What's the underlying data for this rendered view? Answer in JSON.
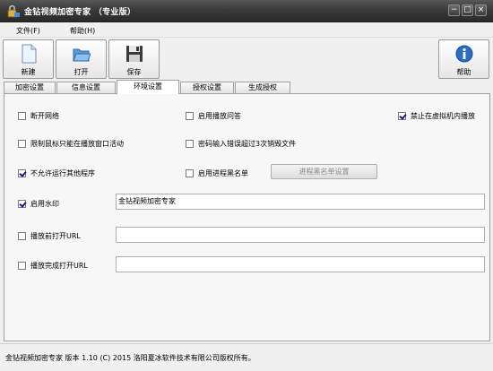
{
  "window": {
    "title": "金钻视频加密专家  （专业版）",
    "controls": {
      "minimize": "−",
      "maximize": "□",
      "close": "×"
    }
  },
  "menu": [
    {
      "label": "文件(F)"
    },
    {
      "label": "帮助(H)"
    }
  ],
  "toolbar": {
    "new_label": "新建",
    "open_label": "打开",
    "save_label": "保存",
    "help_label": "帮助"
  },
  "tabs": [
    {
      "label": "加密设置"
    },
    {
      "label": "信息设置"
    },
    {
      "label": "环境设置",
      "active": true
    },
    {
      "label": "授权设置"
    },
    {
      "label": "生成授权"
    }
  ],
  "options": {
    "disconnect_network": {
      "label": "断开网络",
      "checked": false
    },
    "enable_playback_qa": {
      "label": "启用播放问答",
      "checked": false
    },
    "forbid_vm_playback": {
      "label": "禁止在虚拟机内播放",
      "checked": true
    },
    "restrict_mouse": {
      "label": "限制鼠标只能在播放窗口活动",
      "checked": false
    },
    "destroy_on_wrong_password": {
      "label": "密码输入错误超过3次销毁文件",
      "checked": false
    },
    "disallow_other_programs": {
      "label": "不允许运行其他程序",
      "checked": true
    },
    "enable_process_blacklist": {
      "label": "启用进程黑名单",
      "checked": false
    },
    "enable_watermark": {
      "label": "启用水印",
      "checked": true
    },
    "open_url_before": {
      "label": "播放前打开URL",
      "checked": false
    },
    "open_url_after": {
      "label": "播放完成打开URL",
      "checked": false
    }
  },
  "blacklist_button": "进程黑名单设置",
  "watermark_text": "金钻视频加密专家",
  "url_before_value": "",
  "url_after_value": "",
  "status": "金钻视频加密专家 版本 1.10 (C) 2015 洛阳夏冰软件技术有限公司版权所有。",
  "colors": {
    "titlebar": "#3a3a3a",
    "window_bg": "#f0f0f0",
    "check_mark": "#1a1a8a",
    "help_icon": "#2b6cc4"
  }
}
